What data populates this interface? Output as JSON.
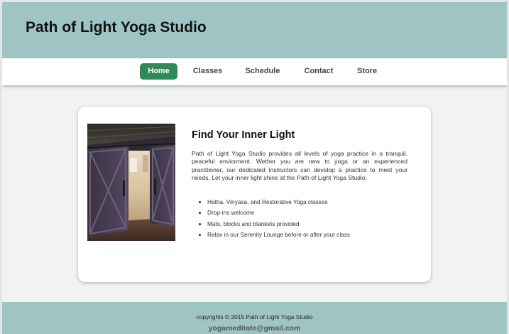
{
  "header": {
    "title": "Path of Light Yoga Studio"
  },
  "nav": {
    "items": [
      {
        "label": "Home",
        "active": true
      },
      {
        "label": "Classes",
        "active": false
      },
      {
        "label": "Schedule",
        "active": false
      },
      {
        "label": "Contact",
        "active": false
      },
      {
        "label": "Store",
        "active": false
      }
    ]
  },
  "main": {
    "image_alt": "Barn door opening to the studio",
    "heading": "Find Your Inner Light",
    "description": "Path of Light Yoga Studio provides all levels of yoga practice in a tranquil, peaceful enviorment. Wether you are new to yoga or an experienced practitioner, our dedicated instructors can develop a practice to meet your needs. Let your inner light shine at the Path of Light Yoga Studio.",
    "features": [
      "Hatha, Vinyasa, and Restorative Yoga classes",
      "Drop-ins welcome",
      "Mats, blocks and blankets provided",
      "Relax in our Serenity Lounge before or after your class"
    ]
  },
  "footer": {
    "copyright": "copyrights © 2015 Path of Light Yoga Studio",
    "email": "yogameditate@gmail.com"
  },
  "colors": {
    "header_bg": "#9fc4c4",
    "active_nav": "#2f8a5a",
    "page_bg": "#f1f3f2"
  }
}
